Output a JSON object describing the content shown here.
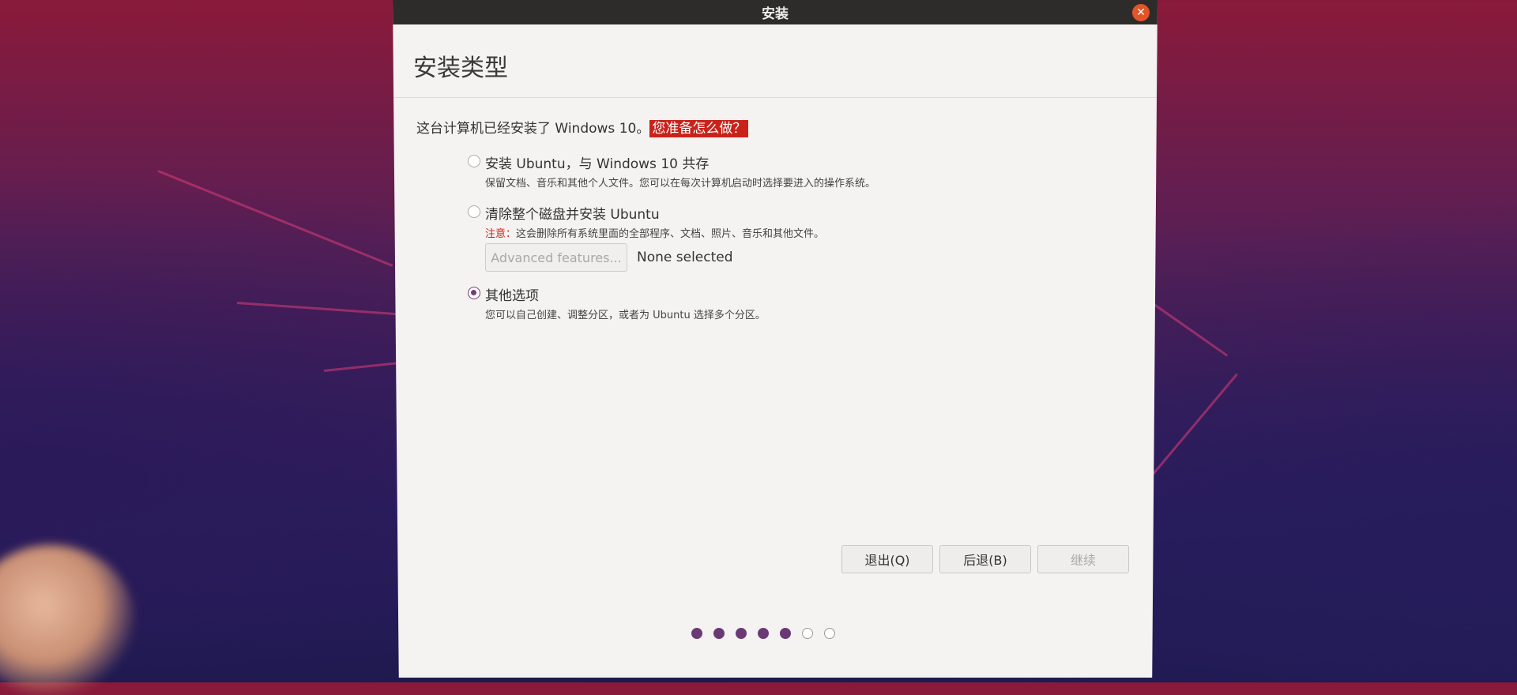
{
  "window": {
    "title": "安装",
    "close_icon": "close-icon"
  },
  "page_title": "安装类型",
  "question": {
    "prefix": "这台计算机已经安装了 Windows 10。",
    "highlight": "您准备怎么做？"
  },
  "options": [
    {
      "label": "安装 Ubuntu，与 Windows 10 共存",
      "description": "保留文档、音乐和其他个人文件。您可以在每次计算机启动时选择要进入的操作系统。",
      "checked": false
    },
    {
      "label": "清除整个磁盘并安装 Ubuntu",
      "note_prefix": "注意：",
      "description": "这会删除所有系统里面的全部程序、文档、照片、音乐和其他文件。",
      "checked": false
    },
    {
      "label": "其他选项",
      "description": "您可以自己创建、调整分区，或者为 Ubuntu 选择多个分区。",
      "checked": true
    }
  ],
  "advanced": {
    "button_label": "Advanced features...",
    "status": "None selected"
  },
  "buttons": {
    "quit": "退出(Q)",
    "back": "后退(B)",
    "continue": "继续"
  },
  "progress": {
    "total_steps": 7,
    "completed_steps": 5
  },
  "colors": {
    "accent": "#6b3a75",
    "highlight": "#c8221a",
    "titlebar": "#2d2c2a"
  }
}
